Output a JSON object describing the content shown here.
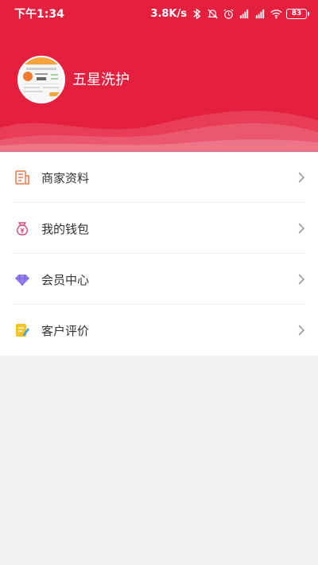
{
  "status_bar": {
    "time": "下午1:34",
    "network_speed": "3.8K/s",
    "battery": "83",
    "icons": [
      "bluetooth-icon",
      "alarm-off-icon",
      "alarm-clock-icon",
      "hd-signal-icon",
      "hd-signal-icon",
      "wifi-icon",
      "battery-icon"
    ]
  },
  "profile": {
    "shop_name": "五星洗护",
    "avatar_icon": "shop-avatar-image"
  },
  "menu": {
    "items": [
      {
        "label": "商家资料",
        "icon": "merchant-info-icon",
        "icon_color": "#e8774a"
      },
      {
        "label": "我的钱包",
        "icon": "wallet-bag-icon",
        "icon_color": "#e0457a"
      },
      {
        "label": "会员中心",
        "icon": "diamond-icon",
        "icon_color": "#8a6ee8"
      },
      {
        "label": "客户评价",
        "icon": "review-note-icon",
        "icon_color": "#f6c428"
      }
    ]
  },
  "theme": {
    "header_color": "#e5203f",
    "background": "#f2f2f5"
  }
}
